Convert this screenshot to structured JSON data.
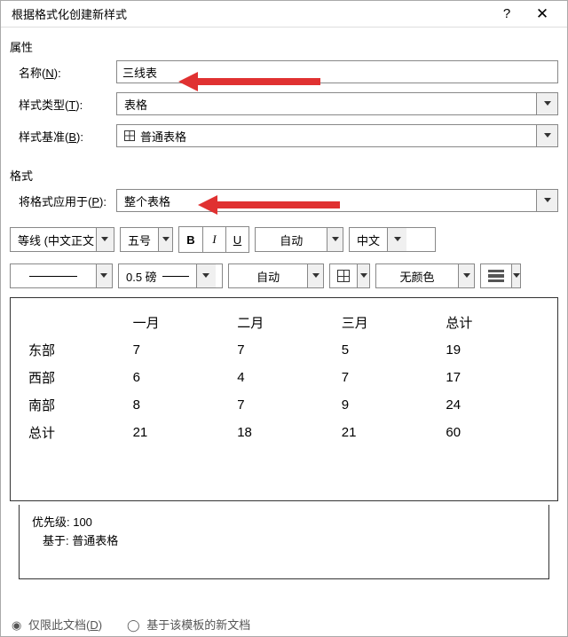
{
  "title": "根据格式化创建新样式",
  "section_props": "属性",
  "section_format": "格式",
  "labels": {
    "name_pre": "名称(",
    "name_key": "N",
    "name_post": "):",
    "type_pre": "样式类型(",
    "type_key": "T",
    "type_post": "):",
    "base_pre": "样式基准(",
    "base_key": "B",
    "base_post": "):",
    "apply_pre": "将格式应用于(",
    "apply_key": "P",
    "apply_post": "):"
  },
  "values": {
    "name": "三线表",
    "type": "表格",
    "base": "普通表格",
    "apply": "整个表格"
  },
  "toolbar1": {
    "font": "等线 (中文正文",
    "size": "五号",
    "b": "B",
    "i": "I",
    "u": "U",
    "color": "自动",
    "lang": "中文"
  },
  "toolbar2": {
    "weight": "0.5 磅",
    "pencolor": "自动",
    "fill": "无颜色"
  },
  "preview_table": {
    "head": [
      "",
      "一月",
      "二月",
      "三月",
      "总计"
    ],
    "rows": [
      [
        "东部",
        "7",
        "7",
        "5",
        "19"
      ],
      [
        "西部",
        "6",
        "4",
        "7",
        "17"
      ],
      [
        "南部",
        "8",
        "7",
        "9",
        "24"
      ],
      [
        "总计",
        "21",
        "18",
        "21",
        "60"
      ]
    ]
  },
  "info": {
    "line1": "优先级: 100",
    "line2": "基于: 普通表格"
  },
  "radios": {
    "opt1_pre": "仅限此文档(",
    "opt1_key": "D",
    "opt1_post": ")",
    "opt2": "基于该模板的新文档"
  }
}
